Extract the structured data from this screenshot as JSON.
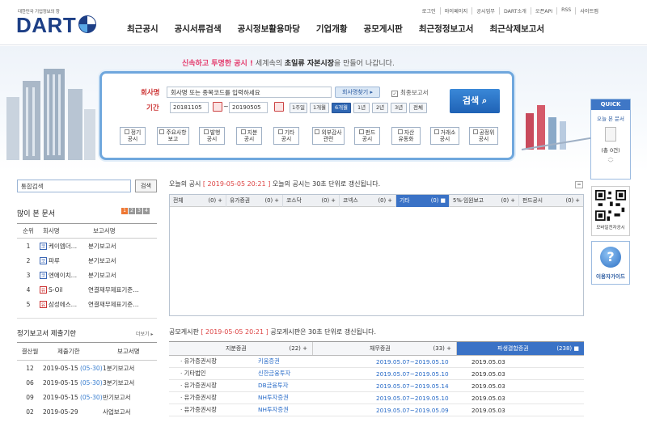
{
  "header": {
    "logo_tagline": "대한민국 기업정보의 창",
    "logo_text": "DART",
    "util_links": [
      "로그인",
      "마이페이지",
      "공시업무",
      "DART소개",
      "오픈API",
      "RSS",
      "사이트맵"
    ],
    "nav": [
      "최근공시",
      "공시서류검색",
      "공시정보활용마당",
      "기업개황",
      "공모게시판",
      "최근정정보고서",
      "최근삭제보고서"
    ]
  },
  "slogan": {
    "part1": "신속하고 투명한 공시 !",
    "part2": " 세계속의 ",
    "part3": "초일류",
    "part4": " 자본시장",
    "part5": "을 만들어 나갑니다."
  },
  "search": {
    "company_label": "회사명",
    "company_placeholder": "회사명 또는 종목코드를 입력하세요",
    "find_button": "회사명찾기 ▸",
    "final_report_label": "최종보고서",
    "period_label": "기간",
    "date_from": "20181105",
    "date_to": "20190505",
    "search_button": "검색",
    "periods": [
      "1주일",
      "1개월",
      "6개월",
      "1년",
      "2년",
      "3년",
      "전체"
    ],
    "active_period": "6개월",
    "categories": [
      {
        "l1": "정기",
        "l2": "공시"
      },
      {
        "l1": "주요사항",
        "l2": "보고"
      },
      {
        "l1": "발행",
        "l2": "공시"
      },
      {
        "l1": "지분",
        "l2": "공시"
      },
      {
        "l1": "기타",
        "l2": "공시"
      },
      {
        "l1": "외부감사",
        "l2": "관련"
      },
      {
        "l1": "펀드",
        "l2": "공시"
      },
      {
        "l1": "자산",
        "l2": "유동화"
      },
      {
        "l1": "거래소",
        "l2": "공시"
      },
      {
        "l1": "공정위",
        "l2": "공시"
      }
    ]
  },
  "left": {
    "total_search_placeholder": "통합검색",
    "total_search_button": "검색",
    "most_viewed_title": "많이 본 문서",
    "pages": [
      "1",
      "2",
      "3",
      "4"
    ],
    "most_headers": [
      "순위",
      "회사명",
      "보고서명"
    ],
    "most_rows": [
      {
        "rank": "1",
        "mark": "코",
        "company": "케이엠더…",
        "report": "분기보고서"
      },
      {
        "rank": "2",
        "mark": "코",
        "company": "파루",
        "report": "분기보고서"
      },
      {
        "rank": "3",
        "mark": "코",
        "company": "엔에이치…",
        "report": "분기보고서"
      },
      {
        "rank": "4",
        "mark": "유",
        "company": "S-Oil",
        "report": "연결재무제표기준…"
      },
      {
        "rank": "5",
        "mark": "유",
        "company": "삼성에스…",
        "report": "연결재무제표기준…"
      }
    ],
    "due_title": "정기보고서 제출기한",
    "more_label": "더보기 ▸",
    "due_headers": [
      "결산월",
      "제출기한",
      "보고서명"
    ],
    "due_rows": [
      {
        "month": "12",
        "date": "2019-05-15",
        "ext": "(05-30)",
        "report": "1분기보고서"
      },
      {
        "month": "06",
        "date": "2019-05-15",
        "ext": "(05-30)",
        "report": "3분기보고서"
      },
      {
        "month": "09",
        "date": "2019-05-15",
        "ext": "(05-30)",
        "report": "반기보고서"
      },
      {
        "month": "02",
        "date": "2019-05-29",
        "ext": "",
        "report": "사업보고서"
      }
    ]
  },
  "today": {
    "prefix": "오늘의 공시",
    "stamp": "[ 2019-05-05 20:21 ]",
    "suffix": "오늘의 공시는 30초 단위로 갱신됩니다.",
    "min_icon": "=",
    "tabs": [
      {
        "label": "전체",
        "count": "(0) +"
      },
      {
        "label": "유가증권",
        "count": "(0) +"
      },
      {
        "label": "코스닥",
        "count": "(0) +"
      },
      {
        "label": "코넥스",
        "count": "(0) +"
      },
      {
        "label": "기타",
        "count": "(0) ■"
      },
      {
        "label": "5%·임원보고",
        "count": "(0) +"
      },
      {
        "label": "펀드공시",
        "count": "(0) +"
      }
    ],
    "active_tab": "기타"
  },
  "board": {
    "prefix": "공모게시판",
    "stamp": "[ 2019-05-05 20:21 ]",
    "suffix": "공모게시판은 30초 단위로 갱신됩니다.",
    "tabs": [
      {
        "label": "지분증권",
        "count": "(22) +"
      },
      {
        "label": "채무증권",
        "count": "(33) +"
      },
      {
        "label": "파생결합증권",
        "count": "(238) ■"
      }
    ],
    "rows": [
      {
        "market": "· 유가증권시장",
        "company": "키움증권",
        "period": "2019.05.07~2019.05.10",
        "date": "2019.05.03"
      },
      {
        "market": "· 기타법인",
        "company": "신한금융투자",
        "period": "2019.05.07~2019.05.10",
        "date": "2019.05.03"
      },
      {
        "market": "· 유가증권시장",
        "company": "DB금융투자",
        "period": "2019.05.07~2019.05.14",
        "date": "2019.05.03"
      },
      {
        "market": "· 유가증권시장",
        "company": "NH투자증권",
        "period": "2019.05.07~2019.05.10",
        "date": "2019.05.03"
      },
      {
        "market": "· 유가증권시장",
        "company": "NH투자증권",
        "period": "2019.05.07~2019.05.09",
        "date": "2019.05.03"
      }
    ]
  },
  "quick": {
    "title": "QUICK",
    "today_docs": "오늘 본 문서",
    "count": "(총 0건)",
    "mobile_caption": "모바일전자공시",
    "guide": "이용자가이드",
    "guide_icon": "?"
  },
  "colors": {
    "brand": "#1d3f86",
    "accent": "#3a72c6",
    "highlight": "#e43a6c"
  }
}
